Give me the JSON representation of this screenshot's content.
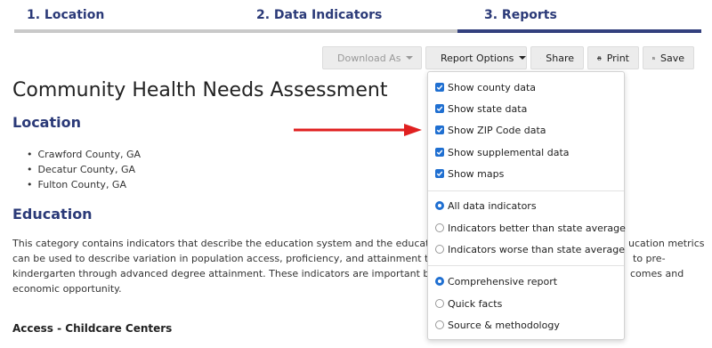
{
  "steps": [
    {
      "label": "1. Location"
    },
    {
      "label": "2. Data Indicators"
    },
    {
      "label": "3. Reports"
    }
  ],
  "toolbar": {
    "download_label": "Download As",
    "report_options_label": "Report Options",
    "share_label": "Share",
    "print_label": "Print",
    "save_label": "Save"
  },
  "page": {
    "title": "Community Health Needs Assessment",
    "location_heading": "Location",
    "locations": [
      "Crawford County, GA",
      "Decatur County, GA",
      "Fulton County, GA"
    ],
    "education_heading": "Education",
    "education_text_lines": [
      "This category contains indicators that describe the education system and the education",
      "can be used to describe variation in population access, proficiency, and attainment thro",
      "kindergarten through advanced degree attainment. These indicators are important beca",
      "economic opportunity."
    ],
    "education_text_right": [
      "ucation metrics",
      "to pre-",
      "comes and"
    ],
    "subsection_heading": "Access - Childcare Centers"
  },
  "dropdown": {
    "checkboxes": [
      {
        "label": "Show county data",
        "checked": true
      },
      {
        "label": "Show state data",
        "checked": true
      },
      {
        "label": "Show ZIP Code data",
        "checked": true
      },
      {
        "label": "Show supplemental data",
        "checked": true
      },
      {
        "label": "Show maps",
        "checked": true
      }
    ],
    "indicator_radios": [
      {
        "label": "All data indicators",
        "selected": true
      },
      {
        "label": "Indicators better than state average",
        "selected": false
      },
      {
        "label": "Indicators worse than state average",
        "selected": false
      }
    ],
    "report_radios": [
      {
        "label": "Comprehensive report",
        "selected": true
      },
      {
        "label": "Quick facts",
        "selected": false
      },
      {
        "label": "Source & methodology",
        "selected": false
      }
    ]
  },
  "colors": {
    "accent": "#2b3a78",
    "checkbox": "#1f6fd1",
    "arrow": "#e02020"
  },
  "icons": {
    "download": "download-icon",
    "report_options": "vertical-dots-icon",
    "share": "share-icon",
    "print": "printer-icon",
    "save": "floppy-disk-icon",
    "arrow": "red-arrow-icon"
  }
}
